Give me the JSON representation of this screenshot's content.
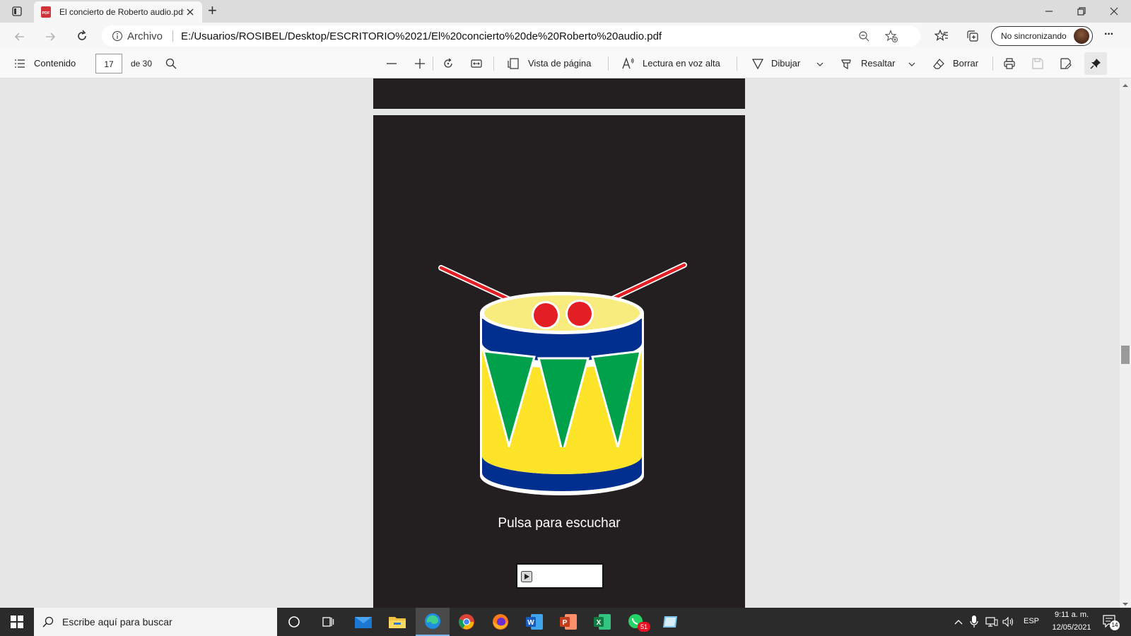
{
  "browser": {
    "tab_title": "El concierto de Roberto audio.pdf",
    "tab_icon": "pdf-icon",
    "new_tab_symbol": "+",
    "info_label": "Archivo",
    "url": "E:/Usuarios/ROSIBEL/Desktop/ESCRITORIO%2021/El%20concierto%20de%20Roberto%20audio.pdf",
    "profile_label": "No sincronizando",
    "more_symbol": "···",
    "window_controls": [
      "minimize",
      "restore",
      "close"
    ]
  },
  "pdf_toolbar": {
    "contents_label": "Contenido",
    "page_number": "17",
    "page_total": "de 30",
    "page_view_label": "Vista de página",
    "read_aloud_label": "Lectura en voz alta",
    "draw_label": "Dibujar",
    "highlight_label": "Resaltar",
    "erase_label": "Borrar"
  },
  "document": {
    "caption": "Pulsa para escuchar",
    "page_background": "#231f20",
    "drum_colors": {
      "body": "#fde428",
      "stripe": "#00a14b",
      "band": "#002f8f",
      "head": "#f9ec7e",
      "stick": "#e31e24"
    }
  },
  "taskbar": {
    "search_placeholder": "Escribe aquí para buscar",
    "apps": [
      "cortana-icon",
      "task-view-icon",
      "mail-icon",
      "file-explorer-icon",
      "edge-icon",
      "chrome-icon",
      "firefox-icon",
      "word-icon",
      "powerpoint-icon",
      "excel-icon",
      "whatsapp-icon",
      "notes-icon"
    ],
    "whatsapp_badge": "51",
    "language": "ESP",
    "time": "9:11 a. m.",
    "date": "12/05/2021",
    "notification_count": "14"
  }
}
